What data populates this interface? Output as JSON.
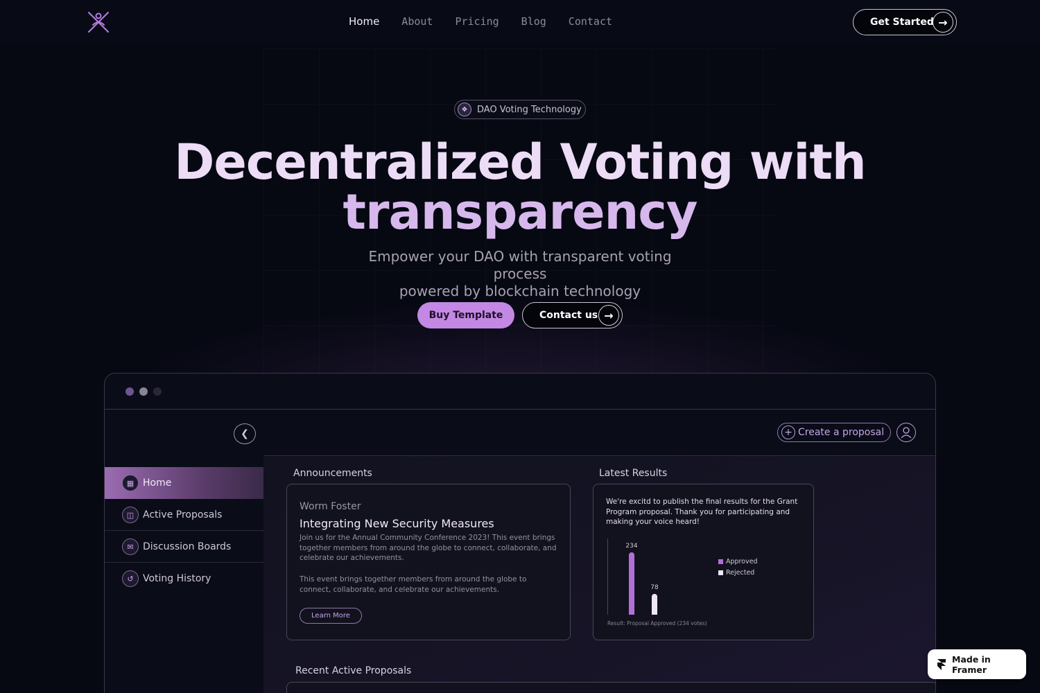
{
  "nav": {
    "logo_icon": "x-figure-logo-icon",
    "links": [
      "Home",
      "About",
      "Pricing",
      "Blog",
      "Contact"
    ],
    "active_link": "Home",
    "cta_label": "Get Started",
    "cta_icon": "arrow-right-icon"
  },
  "hero": {
    "badge": "DAO Voting Technology",
    "badge_icon": "vote-icon",
    "title_line1": "Decentralized Voting with",
    "title_line2": "transparency",
    "subtitle_line1": "Empower your DAO with transparent voting process",
    "subtitle_line2": "powered by blockchain technology",
    "primary_button": "Buy Template",
    "secondary_button": "Contact us"
  },
  "dashboard": {
    "window_dots": [
      "#6f5590",
      "#8a8596",
      "#2a2838"
    ],
    "create_button": "Create a proposal",
    "sidebar": [
      {
        "label": "Home",
        "icon": "grid-icon",
        "active": true
      },
      {
        "label": "Active Proposals",
        "icon": "ballot-box-icon",
        "active": false
      },
      {
        "label": "Discussion Boards",
        "icon": "chat-icon",
        "active": false
      },
      {
        "label": "Voting History",
        "icon": "history-icon",
        "active": false
      }
    ],
    "announcements": {
      "heading": "Announcements",
      "author": "Worm Foster",
      "title": "Integrating New Security Measures",
      "body1": "Join us for the Annual Community Conference 2023! This event brings together members from around the globe to connect, collaborate, and celebrate our achievements.",
      "body2": "This event brings together members from around the globe to connect, collaborate, and celebrate our achievements.",
      "button": "Learn More"
    },
    "results": {
      "heading": "Latest Results",
      "text": "We're excitd to publish the final results for the  Grant Program proposal. Thank you for participating and making your voice heard!",
      "footer": "Result: Proposal Approved (234 votes)"
    },
    "recent_heading": "Recent Active Proposals"
  },
  "chart_data": {
    "type": "bar",
    "categories": [
      "Approved",
      "Rejected"
    ],
    "values": [
      234,
      78
    ],
    "colors": [
      "#b26fd6",
      "#efe6f7"
    ],
    "legend_position": "right",
    "ylim": [
      0,
      260
    ]
  },
  "framer_badge": "Made in Framer",
  "colors": {
    "accent": "#c388e3",
    "background": "#060812"
  }
}
